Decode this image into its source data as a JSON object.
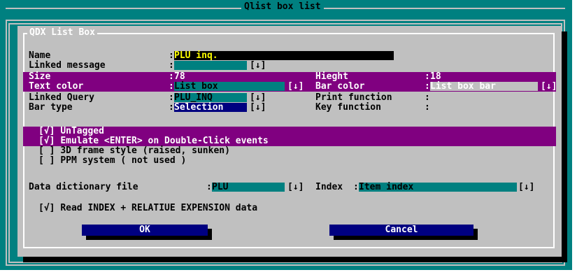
{
  "window": {
    "title": "Qlist box list"
  },
  "dialog": {
    "title": "QDX List Box",
    "labels": {
      "name": "Name",
      "linked_message": "Linked message",
      "size": "Size",
      "text_color": "Text color",
      "linked_query": "Linked Query",
      "bar_type": "Bar type",
      "height": "Hieght",
      "bar_color": "Bar color",
      "print_function": "Print function",
      "key_function": "Key function",
      "data_dictionary_file": "Data dictionary file",
      "index": "Index"
    },
    "values": {
      "name": "PLU inq.",
      "linked_message": "",
      "size": "78",
      "text_color": "List box",
      "linked_query": "PLU_INQ",
      "bar_type": "Selection",
      "height": "18",
      "bar_color": "List box bar",
      "print_function": "",
      "key_function": "",
      "data_dictionary_file": "PLU",
      "index": "Item index"
    },
    "colon": ":",
    "dropdown_glyph": "[↓]",
    "checkboxes": [
      {
        "mark": "[√]",
        "label": "UnTagged",
        "checked": true
      },
      {
        "mark": "[√]",
        "label": "Emulate <ENTER> on Double-Click events",
        "checked": true
      },
      {
        "mark": "[ ]",
        "label": "3D frame style (raised, sunken)",
        "checked": false
      },
      {
        "mark": "[ ]",
        "label": "PPM system ( not used )",
        "checked": false
      },
      {
        "mark": "[√]",
        "label": "Read INDEX + RELATIUE EXPENSION data",
        "checked": true
      }
    ],
    "buttons": {
      "ok": "OK",
      "cancel": "Cancel"
    }
  },
  "colors": {
    "desktop": "#008080",
    "dialog": "#c0c0c0",
    "highlight_bar": "#800080",
    "field_teal": "#008080",
    "field_blue": "#000080",
    "field_black": "#000000",
    "name_text": "#ffff00"
  }
}
